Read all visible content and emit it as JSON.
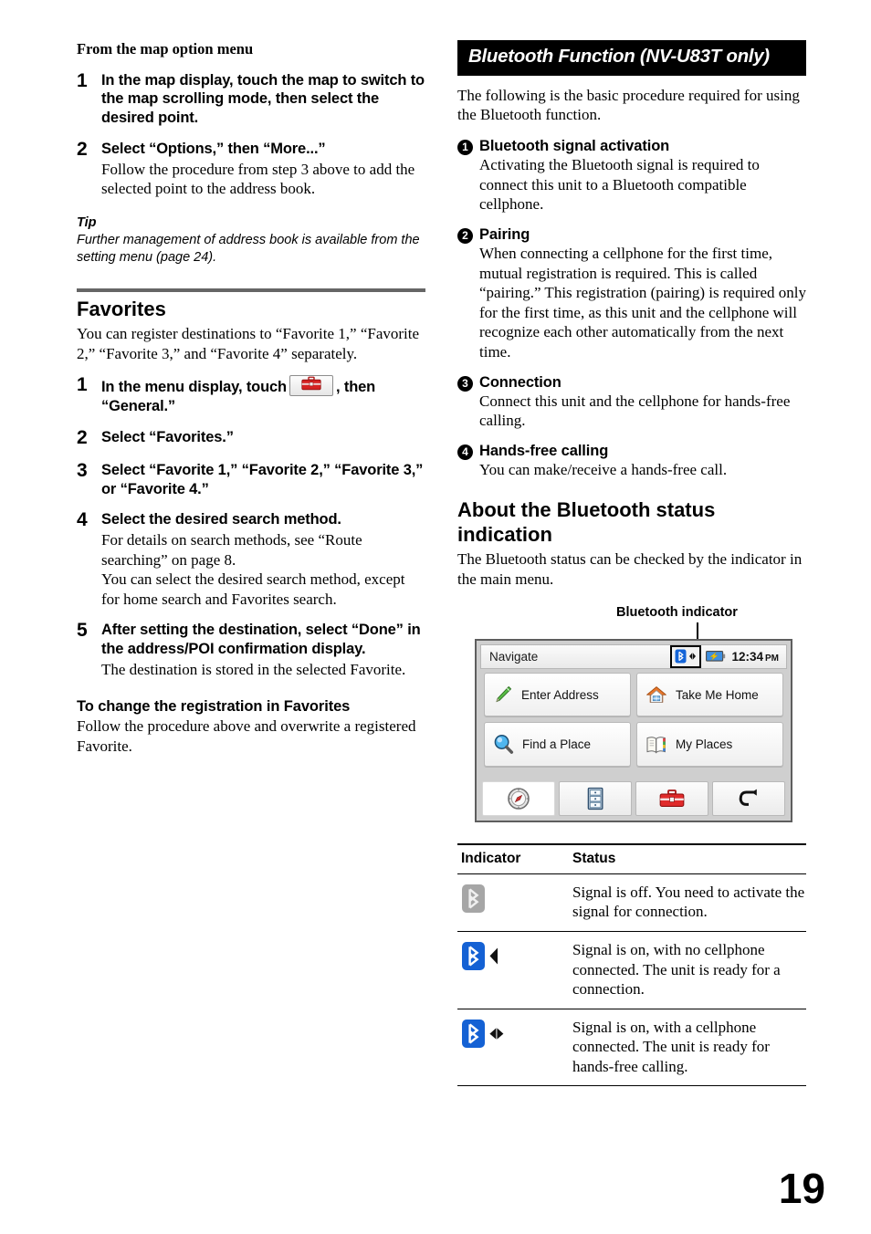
{
  "left": {
    "section_heading": "From the map option menu",
    "steps": [
      {
        "num": "1",
        "title": "In the map display, touch the map to switch to the map scrolling mode, then select the desired point.",
        "desc": ""
      },
      {
        "num": "2",
        "title": "Select “Options,” then “More...”",
        "desc": "Follow the procedure from step 3 above to add the selected point to the address book."
      }
    ],
    "tip": {
      "label": "Tip",
      "text": "Further management of address book is available from the setting menu (page 24)."
    },
    "favorites": {
      "heading": "Favorites",
      "intro": "You can register destinations to “Favorite 1,” “Favorite 2,” “Favorite 3,” and “Favorite 4” separately.",
      "steps": [
        {
          "num": "1",
          "title_before": "In the menu display, touch",
          "icon": "toolbox-icon",
          "title_after": ", then “General.”",
          "desc": ""
        },
        {
          "num": "2",
          "title": "Select “Favorites.”",
          "desc": ""
        },
        {
          "num": "3",
          "title": "Select “Favorite 1,” “Favorite 2,” “Favorite 3,” or “Favorite 4.”",
          "desc": ""
        },
        {
          "num": "4",
          "title": "Select the desired search method.",
          "desc": "For details on search methods, see “Route searching” on page 8.\nYou can select the desired search method, except for home search and Favorites search."
        },
        {
          "num": "5",
          "title": "After setting the destination, select “Done” in the address/POI confirmation display.",
          "desc": "The destination is stored in the selected Favorite."
        }
      ],
      "subheading": "To change the registration in Favorites",
      "subtext": "Follow the procedure above and overwrite a registered Favorite."
    }
  },
  "right": {
    "banner": "Bluetooth Function (NV-U83T only)",
    "intro": "The following is the basic procedure required for using the Bluetooth function.",
    "steps": [
      {
        "num": "1",
        "title": "Bluetooth signal activation",
        "desc": "Activating the Bluetooth signal is required to connect this unit to a Bluetooth compatible cellphone."
      },
      {
        "num": "2",
        "title": "Pairing",
        "desc": "When connecting a cellphone for the first time, mutual registration is required. This is called “pairing.” This registration (pairing) is required only for the first time, as this unit and the cellphone will recognize each other automatically from the next time."
      },
      {
        "num": "3",
        "title": "Connection",
        "desc": "Connect this unit and the cellphone for hands-free calling."
      },
      {
        "num": "4",
        "title": "Hands-free calling",
        "desc": "You can make/receive a hands-free call."
      }
    ],
    "status_section": {
      "heading": "About the Bluetooth status indication",
      "text": "The Bluetooth status can be checked by the indicator in the main menu."
    },
    "callout_label": "Bluetooth indicator",
    "device": {
      "status_title": "Navigate",
      "clock_time": "12:34",
      "clock_ampm": "PM",
      "buttons": [
        {
          "label": "Enter Address",
          "icon": "pencil-icon"
        },
        {
          "label": "Take Me Home",
          "icon": "house-icon"
        },
        {
          "label": "Find a Place",
          "icon": "magnifier-icon"
        },
        {
          "label": "My Places",
          "icon": "book-icon"
        }
      ],
      "tabs": [
        {
          "icon": "compass-icon",
          "active": true
        },
        {
          "icon": "file-cabinet-icon",
          "active": false
        },
        {
          "icon": "toolbox-icon",
          "active": false
        },
        {
          "icon": "back-arrow-icon",
          "active": false
        }
      ]
    },
    "table": {
      "headers": [
        "Indicator",
        "Status"
      ],
      "rows": [
        {
          "indicator": "bluetooth-off-icon",
          "status": "Signal is off. You need to activate the signal for connection."
        },
        {
          "indicator": "bluetooth-ready-icon",
          "status": "Signal is on, with no cellphone connected. The unit is ready for a connection."
        },
        {
          "indicator": "bluetooth-connected-icon",
          "status": "Signal is on, with a cellphone connected. The unit is ready for hands-free calling."
        }
      ]
    }
  },
  "page_number": "19",
  "colors": {
    "banner_bg": "#000000",
    "rule_gray": "#666666",
    "bluetooth_blue": "#1565d8",
    "bluetooth_gray": "#9a9a9a",
    "toolbox_red": "#cc2222",
    "pencil_green": "#44a837",
    "house_orange": "#e8762a"
  }
}
